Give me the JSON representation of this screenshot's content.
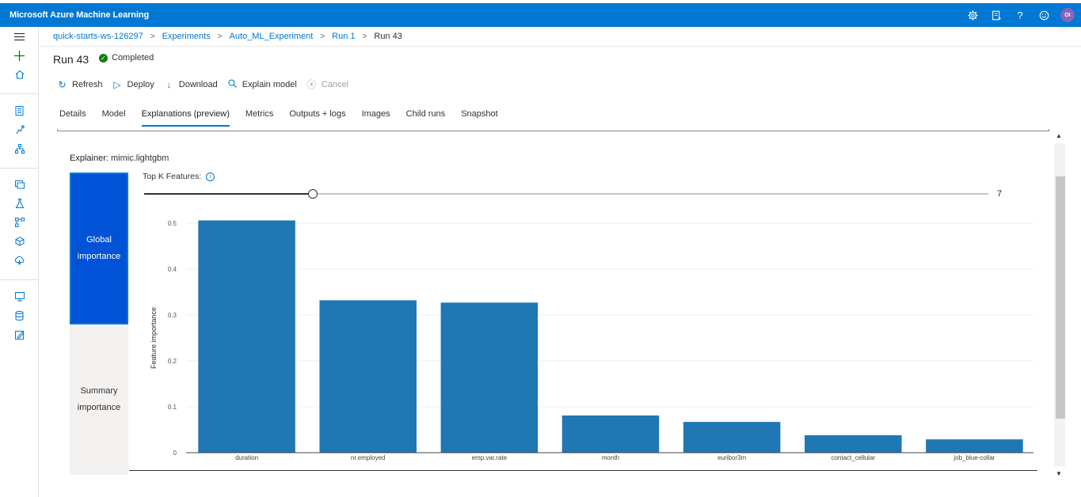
{
  "app": {
    "title": "Microsoft Azure Machine Learning"
  },
  "topbar_icons": [
    "gear-icon",
    "feedback-icon",
    "help-icon",
    "smiley-icon"
  ],
  "user": {
    "initials": "OI"
  },
  "breadcrumb": [
    {
      "label": "quick-starts-ws-126297"
    },
    {
      "label": "Experiments"
    },
    {
      "label": "Auto_ML_Experiment"
    },
    {
      "label": "Run 1"
    },
    {
      "label": "Run 43"
    }
  ],
  "run": {
    "title": "Run 43",
    "status": "Completed",
    "status_color": "#107c10"
  },
  "commands": {
    "refresh": "Refresh",
    "deploy": "Deploy",
    "download": "Download",
    "explain": "Explain model",
    "cancel": "Cancel"
  },
  "tabs": [
    "Details",
    "Model",
    "Explanations (preview)",
    "Metrics",
    "Outputs + logs",
    "Images",
    "Child runs",
    "Snapshot"
  ],
  "active_tab": "Explanations (preview)",
  "explainer": {
    "label": "Explainer:",
    "value": "mimic.lightgbm"
  },
  "toggles": {
    "global": "Global importance",
    "summary": "Summary importance"
  },
  "topk": {
    "label": "Top K Features:",
    "value": "7",
    "fraction": 0.2
  },
  "colors": {
    "accent": "#0078d4",
    "bar": "#1f77b4",
    "global_bg": "#0053d6"
  },
  "chart_data": {
    "type": "bar",
    "categories": [
      "duration",
      "nr.employed",
      "emp.var.rate",
      "month",
      "euribor3m",
      "contact_cellular",
      "job_blue-collar"
    ],
    "values": [
      0.506,
      0.332,
      0.327,
      0.081,
      0.067,
      0.038,
      0.029
    ],
    "xlabel": "",
    "ylabel": "Feature importance",
    "ylim": [
      0,
      0.5
    ],
    "yticks": [
      0,
      0.1,
      0.2,
      0.3,
      0.4,
      0.5
    ],
    "grid": true
  }
}
